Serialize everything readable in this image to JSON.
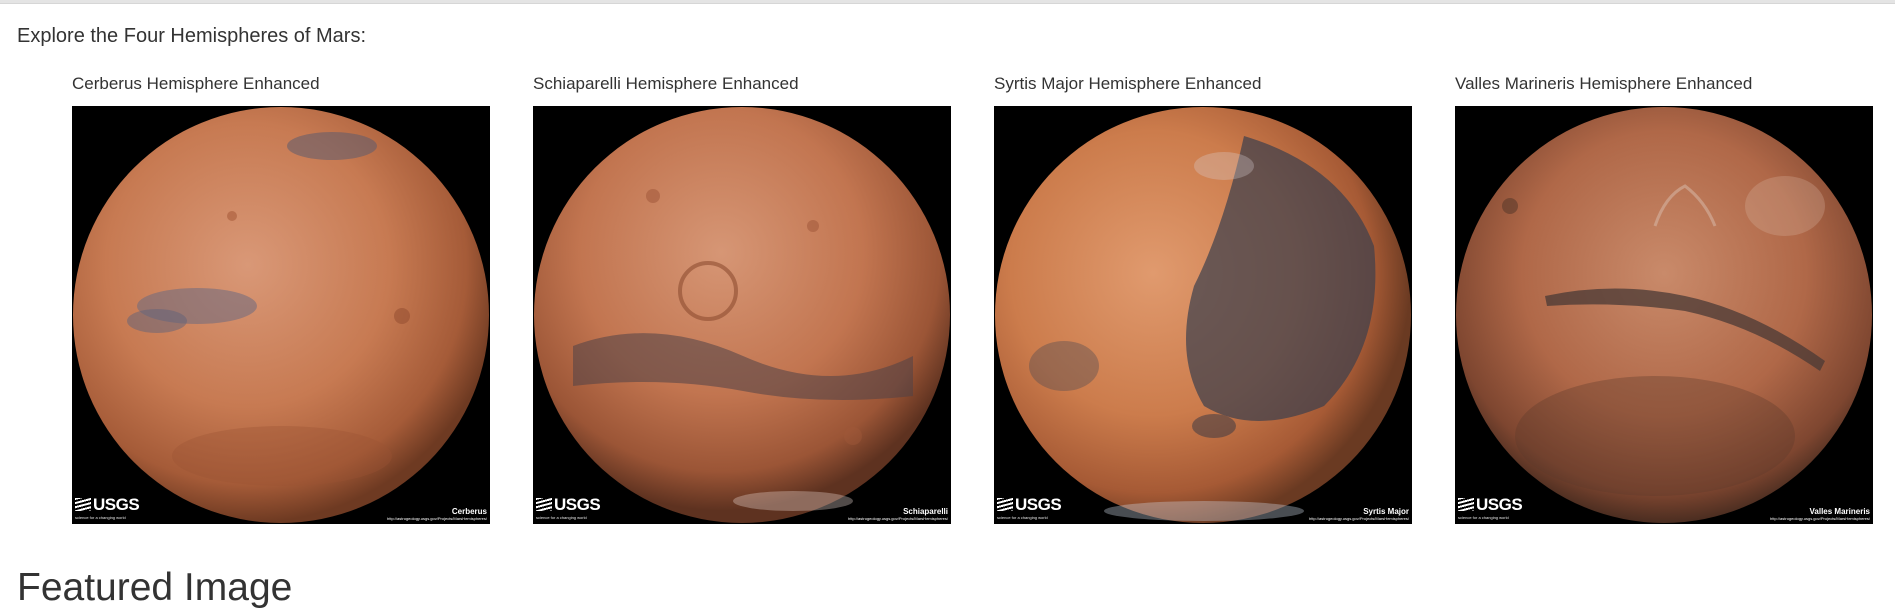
{
  "intro_text": "Explore the Four Hemispheres of Mars:",
  "hemispheres": [
    {
      "title": "Cerberus Hemisphere Enhanced",
      "logo_text": "USGS",
      "logo_tagline": "science for a changing world",
      "caption_name": "Cerberus",
      "caption_url": "http://astrogeology.usgs.gov/Projects/MarsHemispheres/"
    },
    {
      "title": "Schiaparelli Hemisphere Enhanced",
      "logo_text": "USGS",
      "logo_tagline": "science for a changing world",
      "caption_name": "Schiaparelli",
      "caption_url": "http://astrogeology.usgs.gov/Projects/MarsHemispheres/"
    },
    {
      "title": "Syrtis Major Hemisphere Enhanced",
      "logo_text": "USGS",
      "logo_tagline": "science for a changing world",
      "caption_name": "Syrtis Major",
      "caption_url": "http://astrogeology.usgs.gov/Projects/MarsHemispheres/"
    },
    {
      "title": "Valles Marineris Hemisphere Enhanced",
      "logo_text": "USGS",
      "logo_tagline": "science for a changing world",
      "caption_name": "Valles Marineris",
      "caption_url": "http://astrogeology.usgs.gov/Projects/MarsHemispheres/"
    }
  ],
  "featured_heading": "Featured Image",
  "colors": {
    "text": "#333333",
    "image_background": "#000000",
    "mars_base": "#c77a52",
    "mars_dark": "#3a3436",
    "top_rule": "#e4e4e4"
  }
}
